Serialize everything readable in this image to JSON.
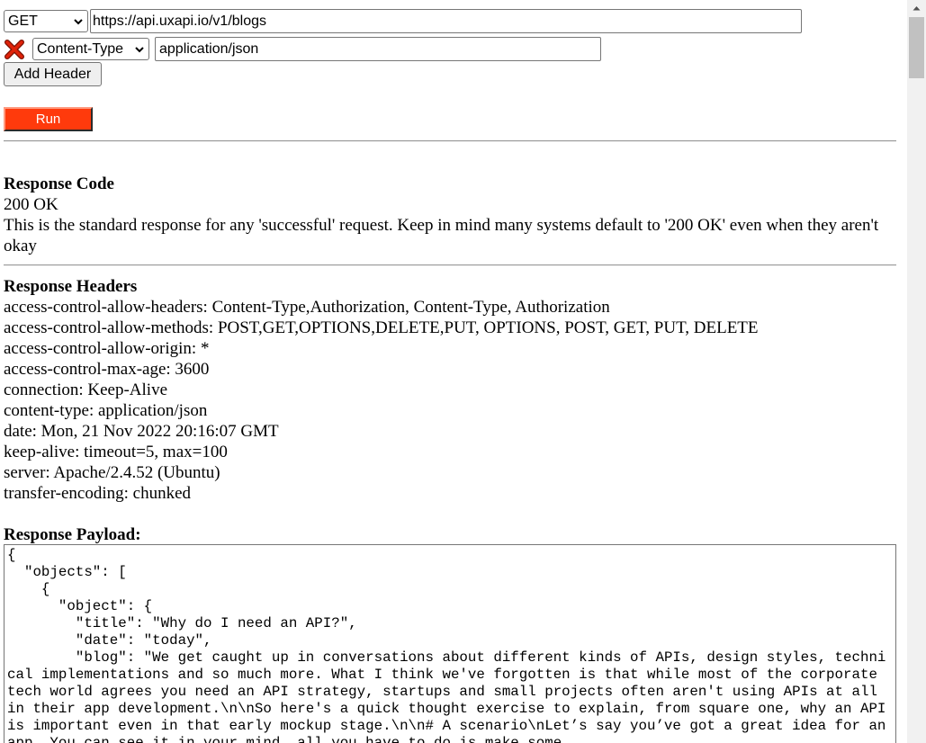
{
  "request": {
    "method": "GET",
    "url": "https://api.uxapi.io/v1/blogs",
    "header_name": "Content-Type",
    "header_value": "application/json",
    "add_header_label": "Add Header",
    "run_label": "Run",
    "run_color": "#ff3a0c"
  },
  "response_code": {
    "heading": "Response Code",
    "code": "200 OK",
    "description": "This is the standard response for any 'successful' request. Keep in mind many systems default to '200 OK' even when they aren't okay"
  },
  "response_headers": {
    "heading": "Response Headers",
    "lines": [
      "access-control-allow-headers: Content-Type,Authorization, Content-Type, Authorization",
      "access-control-allow-methods: POST,GET,OPTIONS,DELETE,PUT, OPTIONS, POST, GET, PUT, DELETE",
      "access-control-allow-origin: *",
      "access-control-max-age: 3600",
      "connection: Keep-Alive",
      "content-type: application/json",
      "date: Mon, 21 Nov 2022 20:16:07 GMT",
      "keep-alive: timeout=5, max=100",
      "server: Apache/2.4.52 (Ubuntu)",
      "transfer-encoding: chunked"
    ]
  },
  "response_payload": {
    "heading": "Response Payload:",
    "text": "{\n  \"objects\": [\n    {\n      \"object\": {\n        \"title\": \"Why do I need an API?\",\n        \"date\": \"today\",\n        \"blog\": \"We get caught up in conversations about different kinds of APIs, design styles, technical implementations and so much more. What I think we've forgotten is that while most of the corporate tech world agrees you need an API strategy, startups and small projects often aren't using APIs at all in their app development.\\n\\nSo here's a quick thought exercise to explain, from square one, why an API is important even in that early mockup stage.\\n\\n# A scenario\\nLet’s say you’ve got a great idea for an app. You can see it in your mind, all you have to do is make some"
  },
  "icons": {
    "remove_header": "close-x-icon",
    "select_arrow": "chevron-down-icon",
    "scroll_up": "scroll-up-arrow-icon"
  }
}
